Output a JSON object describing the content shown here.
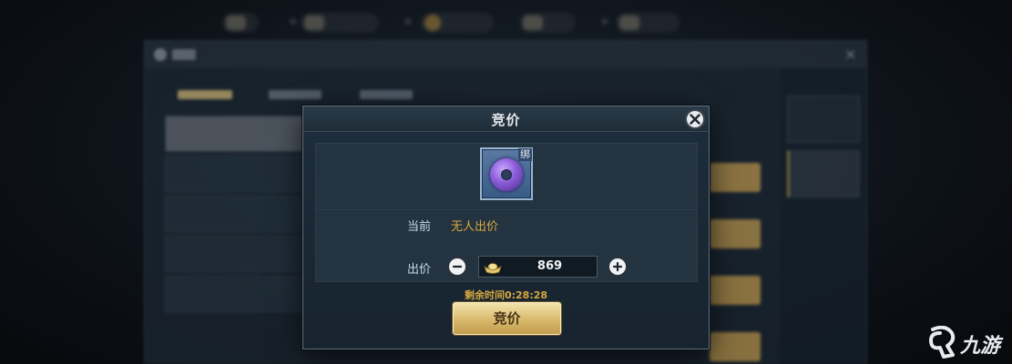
{
  "dialog": {
    "title": "竞价",
    "item": {
      "bind_tag": "绑",
      "icon": "purple-ring-icon"
    },
    "current_label": "当前",
    "current_value": "无人出价",
    "bid_label": "出价",
    "bid_value": "869",
    "remaining_time": "剩余时间0:28:28",
    "confirm_label": "竞价"
  },
  "watermark": {
    "text": "九游"
  },
  "colors": {
    "accent_gold": "#d7a83e",
    "button_gold": "#d8b96c",
    "panel_bg": "#1e2d3b"
  }
}
